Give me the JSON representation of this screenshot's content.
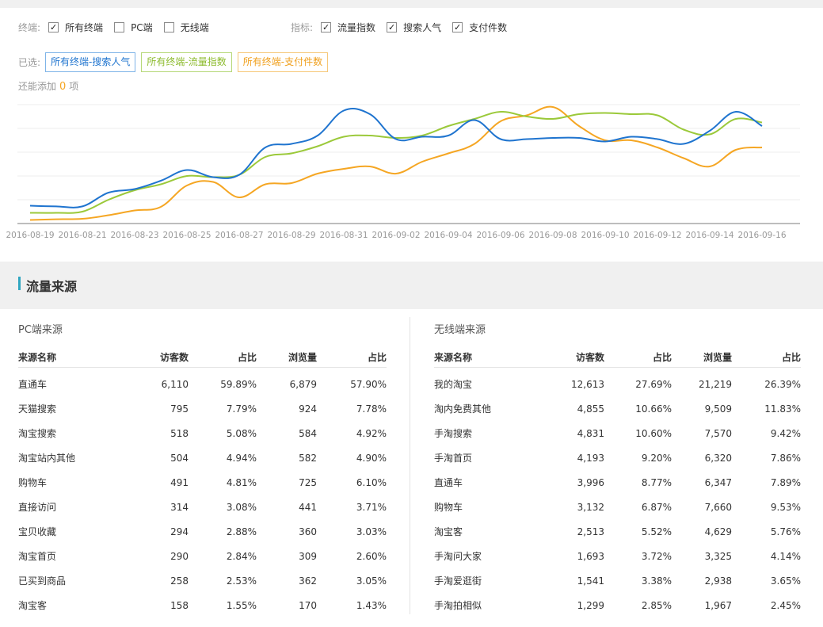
{
  "filters": {
    "terminal_label": "终端:",
    "terminal_options": [
      {
        "label": "所有终端",
        "checked": true
      },
      {
        "label": "PC端",
        "checked": false
      },
      {
        "label": "无线端",
        "checked": false
      }
    ],
    "metric_label": "指标:",
    "metric_options": [
      {
        "label": "流量指数",
        "checked": true
      },
      {
        "label": "搜索人气",
        "checked": true
      },
      {
        "label": "支付件数",
        "checked": true
      }
    ]
  },
  "selected": {
    "label": "已选:",
    "tags": [
      "所有终端-搜索人气",
      "所有终端-流量指数",
      "所有终端-支付件数"
    ]
  },
  "remaining": {
    "prefix": "还能添加",
    "count": "0",
    "suffix": "项"
  },
  "colors": {
    "blue": "#1f74cf",
    "green": "#9bc93a",
    "orange": "#f5a623"
  },
  "chart_data": {
    "type": "line",
    "x": [
      "2016-08-19",
      "2016-08-20",
      "2016-08-21",
      "2016-08-22",
      "2016-08-23",
      "2016-08-24",
      "2016-08-25",
      "2016-08-26",
      "2016-08-27",
      "2016-08-28",
      "2016-08-29",
      "2016-08-30",
      "2016-08-31",
      "2016-09-01",
      "2016-09-02",
      "2016-09-03",
      "2016-09-04",
      "2016-09-05",
      "2016-09-06",
      "2016-09-07",
      "2016-09-08",
      "2016-09-09",
      "2016-09-10",
      "2016-09-11",
      "2016-09-12",
      "2016-09-13",
      "2016-09-14",
      "2016-09-15",
      "2016-09-16",
      "2016-09-17"
    ],
    "tick_labels": [
      "2016-08-19",
      "2016-08-21",
      "2016-08-23",
      "2016-08-25",
      "2016-08-27",
      "2016-08-29",
      "2016-08-31",
      "2016-09-02",
      "2016-09-04",
      "2016-09-06",
      "2016-09-08",
      "2016-09-10",
      "2016-09-12",
      "2016-09-14",
      "2016-09-16"
    ],
    "ylim": [
      0,
      5
    ],
    "grid": true,
    "series": [
      {
        "name": "所有终端-搜索人气",
        "color": "#1f74cf",
        "values": [
          0.75,
          0.72,
          0.72,
          1.3,
          1.45,
          1.8,
          2.25,
          1.95,
          2.05,
          3.2,
          3.35,
          3.7,
          4.75,
          4.6,
          3.55,
          3.65,
          3.7,
          4.35,
          3.55,
          3.55,
          3.6,
          3.6,
          3.45,
          3.65,
          3.55,
          3.35,
          3.9,
          4.7,
          4.1,
          null
        ]
      },
      {
        "name": "所有终端-流量指数",
        "color": "#9bc93a",
        "values": [
          0.45,
          0.45,
          0.5,
          1.0,
          1.4,
          1.65,
          2.0,
          1.95,
          2.05,
          2.8,
          2.95,
          3.25,
          3.65,
          3.7,
          3.6,
          3.7,
          4.1,
          4.4,
          4.7,
          4.5,
          4.4,
          4.6,
          4.65,
          4.6,
          4.55,
          3.95,
          3.75,
          4.4,
          4.25,
          null
        ]
      },
      {
        "name": "所有终端-支付件数",
        "color": "#f5a623",
        "values": [
          0.15,
          0.18,
          0.2,
          0.35,
          0.55,
          0.7,
          1.6,
          1.75,
          1.1,
          1.65,
          1.7,
          2.1,
          2.3,
          2.4,
          2.1,
          2.6,
          2.95,
          3.35,
          4.3,
          4.55,
          4.9,
          4.1,
          3.5,
          3.5,
          3.2,
          2.75,
          2.4,
          3.1,
          3.2,
          null
        ]
      }
    ]
  },
  "traffic": {
    "title": "流量来源",
    "pc": {
      "title": "PC端来源",
      "headers": [
        "来源名称",
        "访客数",
        "占比",
        "浏览量",
        "占比"
      ],
      "rows": [
        [
          "直通车",
          "6,110",
          "59.89%",
          "6,879",
          "57.90%"
        ],
        [
          "天猫搜索",
          "795",
          "7.79%",
          "924",
          "7.78%"
        ],
        [
          "淘宝搜索",
          "518",
          "5.08%",
          "584",
          "4.92%"
        ],
        [
          "淘宝站内其他",
          "504",
          "4.94%",
          "582",
          "4.90%"
        ],
        [
          "购物车",
          "491",
          "4.81%",
          "725",
          "6.10%"
        ],
        [
          "直接访问",
          "314",
          "3.08%",
          "441",
          "3.71%"
        ],
        [
          "宝贝收藏",
          "294",
          "2.88%",
          "360",
          "3.03%"
        ],
        [
          "淘宝首页",
          "290",
          "2.84%",
          "309",
          "2.60%"
        ],
        [
          "已买到商品",
          "258",
          "2.53%",
          "362",
          "3.05%"
        ],
        [
          "淘宝客",
          "158",
          "1.55%",
          "170",
          "1.43%"
        ]
      ]
    },
    "mobile": {
      "title": "无线端来源",
      "headers": [
        "来源名称",
        "访客数",
        "占比",
        "浏览量",
        "占比"
      ],
      "rows": [
        [
          "我的淘宝",
          "12,613",
          "27.69%",
          "21,219",
          "26.39%"
        ],
        [
          "淘内免费其他",
          "4,855",
          "10.66%",
          "9,509",
          "11.83%"
        ],
        [
          "手淘搜索",
          "4,831",
          "10.60%",
          "7,570",
          "9.42%"
        ],
        [
          "手淘首页",
          "4,193",
          "9.20%",
          "6,320",
          "7.86%"
        ],
        [
          "直通车",
          "3,996",
          "8.77%",
          "6,347",
          "7.89%"
        ],
        [
          "购物车",
          "3,132",
          "6.87%",
          "7,660",
          "9.53%"
        ],
        [
          "淘宝客",
          "2,513",
          "5.52%",
          "4,629",
          "5.76%"
        ],
        [
          "手淘问大家",
          "1,693",
          "3.72%",
          "3,325",
          "4.14%"
        ],
        [
          "手淘爱逛街",
          "1,541",
          "3.38%",
          "2,938",
          "3.65%"
        ],
        [
          "手淘拍相似",
          "1,299",
          "2.85%",
          "1,967",
          "2.45%"
        ]
      ]
    }
  }
}
